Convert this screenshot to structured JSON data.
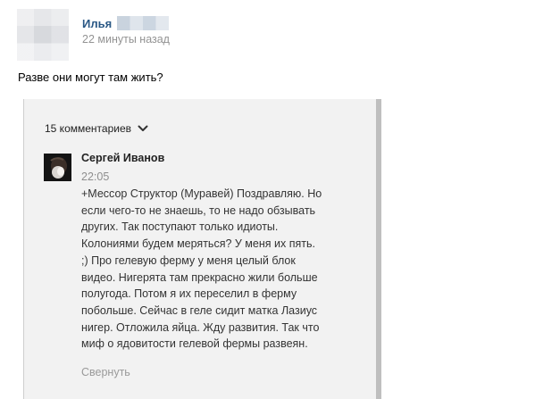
{
  "post": {
    "author_name": "Илья",
    "time": "22 минуты назад",
    "text": "Разве они могут там жить?"
  },
  "embed": {
    "comments_count_label": "15 комментариев",
    "comment": {
      "author": "Сергей Иванов",
      "time": "22:05",
      "lines": [
        "+Мессор Структор (Муравей) Поздравляю. Но",
        "если чего-то не знаешь, то не надо обзывать",
        "других. Так поступают только идиоты.",
        "Колониями будем меряться? У меня их пять.",
        ";) Про гелевую ферму у меня целый блок",
        "видео. Нигерята там прекрасно жили больше",
        "полугода. Потом я их переселил в ферму",
        "побольше. Сейчас в геле сидит матка Лазиус",
        "нигер. Отложила яйца. Жду развития. Так что",
        "миф о ядовитости гелевой фермы развеян."
      ],
      "collapse_label": "Свернуть"
    }
  },
  "icons": {
    "expand": "chevron-down-icon"
  },
  "colors": {
    "author_link": "#2a5885",
    "muted": "#939393",
    "embed_background": "#f2f2f2"
  }
}
